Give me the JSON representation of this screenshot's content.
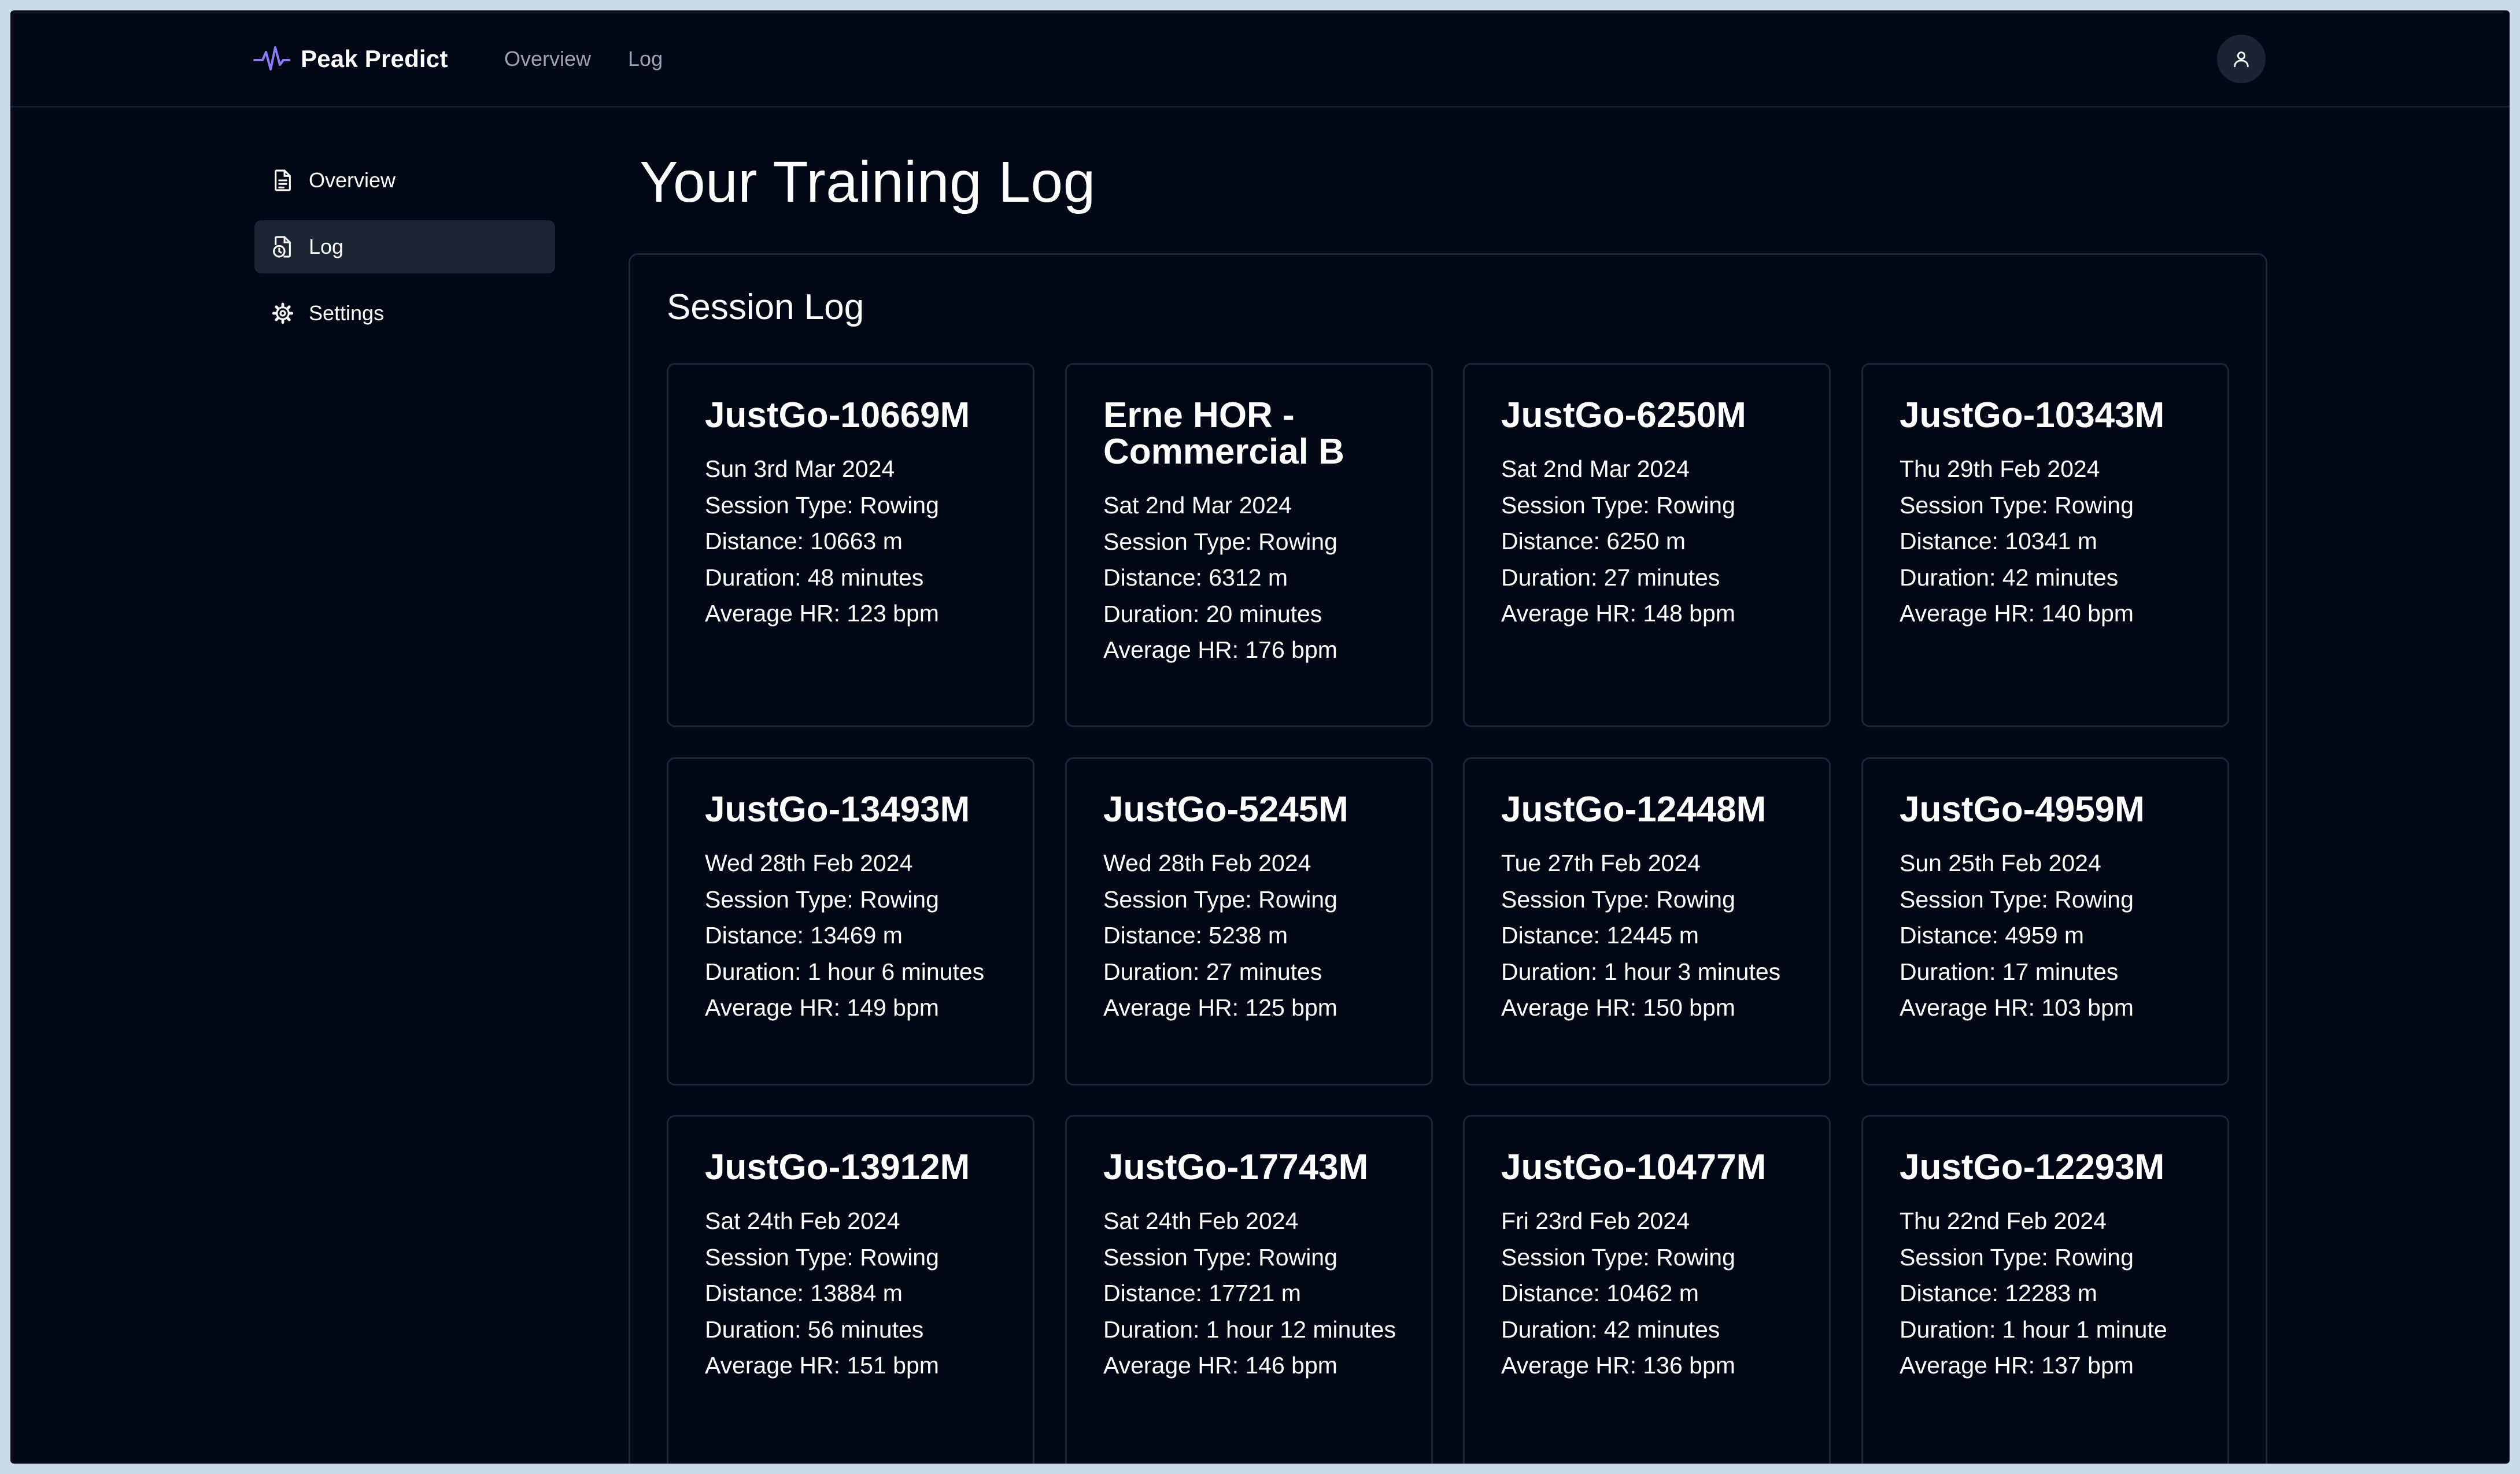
{
  "app": {
    "name": "Peak Predict"
  },
  "topnav": {
    "items": [
      "Overview",
      "Log"
    ]
  },
  "sidebar": {
    "items": [
      {
        "label": "Overview",
        "icon": "document-icon"
      },
      {
        "label": "Log",
        "icon": "file-clock-icon",
        "active": true
      },
      {
        "label": "Settings",
        "icon": "gear-icon"
      }
    ]
  },
  "page": {
    "title": "Your Training Log"
  },
  "session_log": {
    "title": "Session Log",
    "cards": [
      {
        "title": "JustGo-10669M",
        "date": "Sun 3rd Mar 2024",
        "type": "Session Type: Rowing",
        "distance": "Distance: 10663 m",
        "duration": "Duration: 48 minutes",
        "hr": "Average HR: 123 bpm"
      },
      {
        "title": "Erne HOR - Commercial B",
        "date": "Sat 2nd Mar 2024",
        "type": "Session Type: Rowing",
        "distance": "Distance: 6312 m",
        "duration": "Duration: 20 minutes",
        "hr": "Average HR: 176 bpm"
      },
      {
        "title": "JustGo-6250M",
        "date": "Sat 2nd Mar 2024",
        "type": "Session Type: Rowing",
        "distance": "Distance: 6250 m",
        "duration": "Duration: 27 minutes",
        "hr": "Average HR: 148 bpm"
      },
      {
        "title": "JustGo-10343M",
        "date": "Thu 29th Feb 2024",
        "type": "Session Type: Rowing",
        "distance": "Distance: 10341 m",
        "duration": "Duration: 42 minutes",
        "hr": "Average HR: 140 bpm"
      },
      {
        "title": "JustGo-13493M",
        "date": "Wed 28th Feb 2024",
        "type": "Session Type: Rowing",
        "distance": "Distance: 13469 m",
        "duration": "Duration: 1 hour 6 minutes",
        "hr": "Average HR: 149 bpm"
      },
      {
        "title": "JustGo-5245M",
        "date": "Wed 28th Feb 2024",
        "type": "Session Type: Rowing",
        "distance": "Distance: 5238 m",
        "duration": "Duration: 27 minutes",
        "hr": "Average HR: 125 bpm"
      },
      {
        "title": "JustGo-12448M",
        "date": "Tue 27th Feb 2024",
        "type": "Session Type: Rowing",
        "distance": "Distance: 12445 m",
        "duration": "Duration: 1 hour 3 minutes",
        "hr": "Average HR: 150 bpm"
      },
      {
        "title": "JustGo-4959M",
        "date": "Sun 25th Feb 2024",
        "type": "Session Type: Rowing",
        "distance": "Distance: 4959 m",
        "duration": "Duration: 17 minutes",
        "hr": "Average HR: 103 bpm"
      },
      {
        "title": "JustGo-13912M",
        "date": "Sat 24th Feb 2024",
        "type": "Session Type: Rowing",
        "distance": "Distance: 13884 m",
        "duration": "Duration: 56 minutes",
        "hr": "Average HR: 151 bpm"
      },
      {
        "title": "JustGo-17743M",
        "date": "Sat 24th Feb 2024",
        "type": "Session Type: Rowing",
        "distance": "Distance: 17721 m",
        "duration": "Duration: 1 hour 12 minutes",
        "hr": "Average HR: 146 bpm"
      },
      {
        "title": "JustGo-10477M",
        "date": "Fri 23rd Feb 2024",
        "type": "Session Type: Rowing",
        "distance": "Distance: 10462 m",
        "duration": "Duration: 42 minutes",
        "hr": "Average HR: 136 bpm"
      },
      {
        "title": "JustGo-12293M",
        "date": "Thu 22nd Feb 2024",
        "type": "Session Type: Rowing",
        "distance": "Distance: 12283 m",
        "duration": "Duration: 1 hour 1 minute",
        "hr": "Average HR: 137 bpm"
      }
    ]
  },
  "colors": {
    "background": "#030816",
    "accent": "#8b7cf6",
    "border": "#1d2535",
    "active_bg": "#1d2434"
  }
}
